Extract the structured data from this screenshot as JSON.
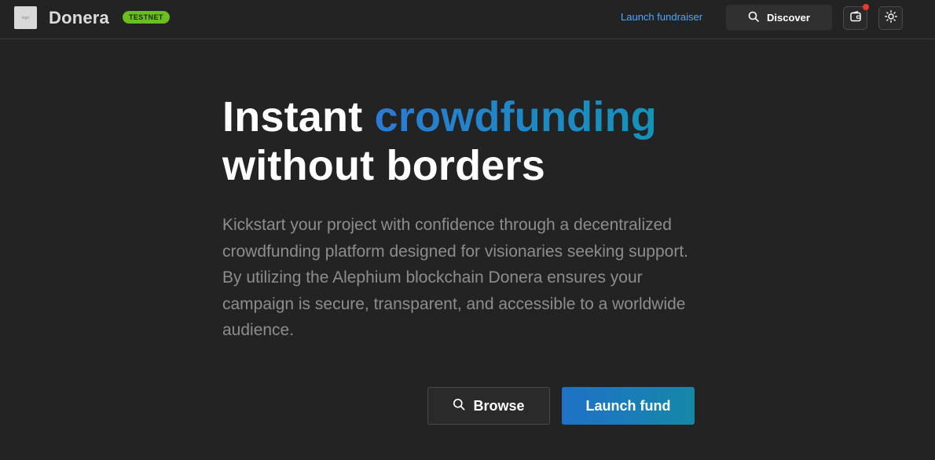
{
  "header": {
    "logo_alt": "logo",
    "brand": "Donera",
    "badge": "TESTNET",
    "launch_link": "Launch fundraiser",
    "discover_label": "Discover"
  },
  "hero": {
    "title_word1": "Instant",
    "title_accent": "crowdfunding",
    "title_line2": "without borders",
    "description": "Kickstart your project with confidence through a decentralized crowdfunding platform designed for visionaries seeking support. By utilizing the Alephium blockchain Donera ensures your campaign is secure, transparent, and accessible to a worldwide audience."
  },
  "actions": {
    "browse_label": "Browse",
    "launch_label": "Launch fund"
  },
  "icons": {
    "search": "search-icon",
    "wallet": "wallet-icon",
    "theme": "sun-icon"
  },
  "colors": {
    "background": "#232323",
    "badge": "#6abe1f",
    "link": "#4aa8ff",
    "accent_start": "#2b7bd4",
    "accent_end": "#1593b8",
    "notification": "#e83a2e"
  }
}
